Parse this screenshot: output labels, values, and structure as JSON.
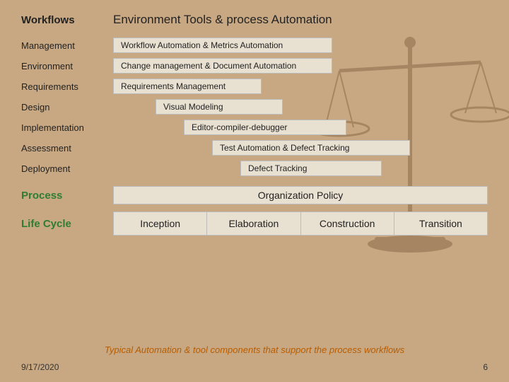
{
  "header": {
    "workflows_label": "Workflows",
    "title": "Environment Tools & process Automation"
  },
  "rows": [
    {
      "label": "Management",
      "bar": "Workflow Automation & Metrics Automation",
      "bar_class": "bar bar-workflow-auto"
    },
    {
      "label": "Environment",
      "bar": "Change management & Document Automation",
      "bar_class": "bar bar-change-mgmt"
    },
    {
      "label": "Requirements",
      "bar": "Requirements Management",
      "bar_class": "bar bar-req-mgmt"
    },
    {
      "label": "Design",
      "bar": "Visual Modeling",
      "bar_class": "bar bar-visual"
    },
    {
      "label": "Implementation",
      "bar": "Editor-compiler-debugger",
      "bar_class": "bar bar-editor"
    },
    {
      "label": "Assessment",
      "bar": "Test Automation & Defect Tracking",
      "bar_class": "bar bar-test-auto"
    },
    {
      "label": "Deployment",
      "bar": "Defect Tracking",
      "bar_class": "bar bar-defect"
    }
  ],
  "process": {
    "label": "Process",
    "bar_text": "Organization Policy"
  },
  "lifecycle": {
    "label": "Life Cycle",
    "cells": [
      "Inception",
      "Elaboration",
      "Construction",
      "Transition"
    ]
  },
  "footer": {
    "description": "Typical Automation & tool components that support the process workflows",
    "date": "9/17/2020",
    "page": "6"
  }
}
